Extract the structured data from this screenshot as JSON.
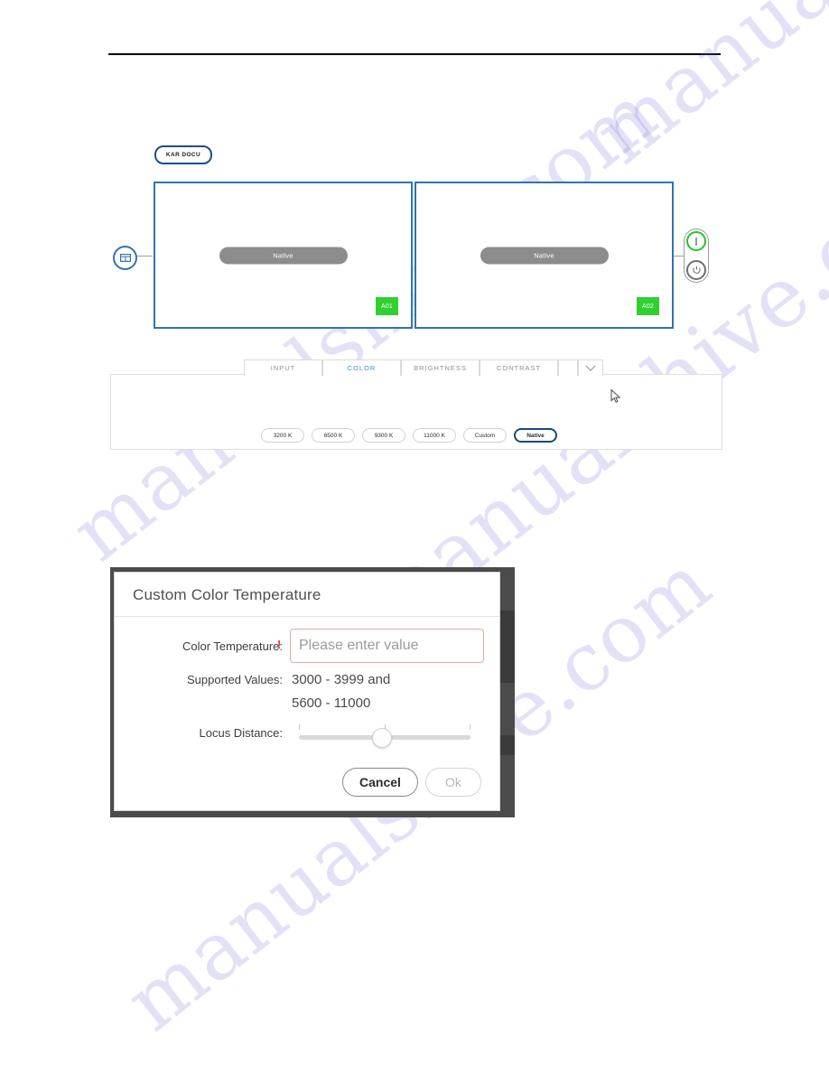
{
  "watermark": {
    "text": "manualshive.com"
  },
  "badge": {
    "label": "KAR DOCU"
  },
  "icons": {
    "grid": "grid-icon",
    "cursor": "mouse-cursor"
  },
  "panels": [
    {
      "preset_label": "Native",
      "tag": "A01"
    },
    {
      "preset_label": "Native",
      "tag": "A02"
    }
  ],
  "power_toggle": {
    "on_label": "I",
    "off_label": "power-symbol",
    "state": "on",
    "on_color": "#22c522",
    "off_color": "#6e6e6e"
  },
  "tabs": [
    {
      "label": "INPUT",
      "active": false
    },
    {
      "label": "COLOR",
      "active": true
    },
    {
      "label": "BRIGHTNESS",
      "active": false
    },
    {
      "label": "CONTRAST",
      "active": false
    },
    {
      "label": "",
      "active": false
    },
    {
      "label": "chevron-down-icon",
      "active": false
    }
  ],
  "presets": [
    {
      "label": "3200 K",
      "selected": false
    },
    {
      "label": "6500 K",
      "selected": false
    },
    {
      "label": "9300 K",
      "selected": false
    },
    {
      "label": "11000 K",
      "selected": false
    },
    {
      "label": "Custom",
      "selected": false
    },
    {
      "label": "Native",
      "selected": true
    }
  ],
  "dialog": {
    "title": "Custom Color Temperature",
    "color_temperature_label": "Color Temperature:",
    "required_mark": "!",
    "color_temperature_placeholder": "Please enter value",
    "color_temperature_value": "",
    "supported_values_label": "Supported Values:",
    "supported_values_line1": "3000 - 3999 and",
    "supported_values_line2": "5600 - 11000",
    "locus_distance_label": "Locus Distance:",
    "locus_distance_percent": 48,
    "cancel_label": "Cancel",
    "ok_label": "Ok"
  },
  "colors": {
    "panel_border": "#2f73b6",
    "tag_green": "#2fd02f",
    "accent_blue": "#3b8fd4",
    "selected_border": "#16497e",
    "required_red": "#e03b3b",
    "input_error_border": "#e6a6a6"
  }
}
